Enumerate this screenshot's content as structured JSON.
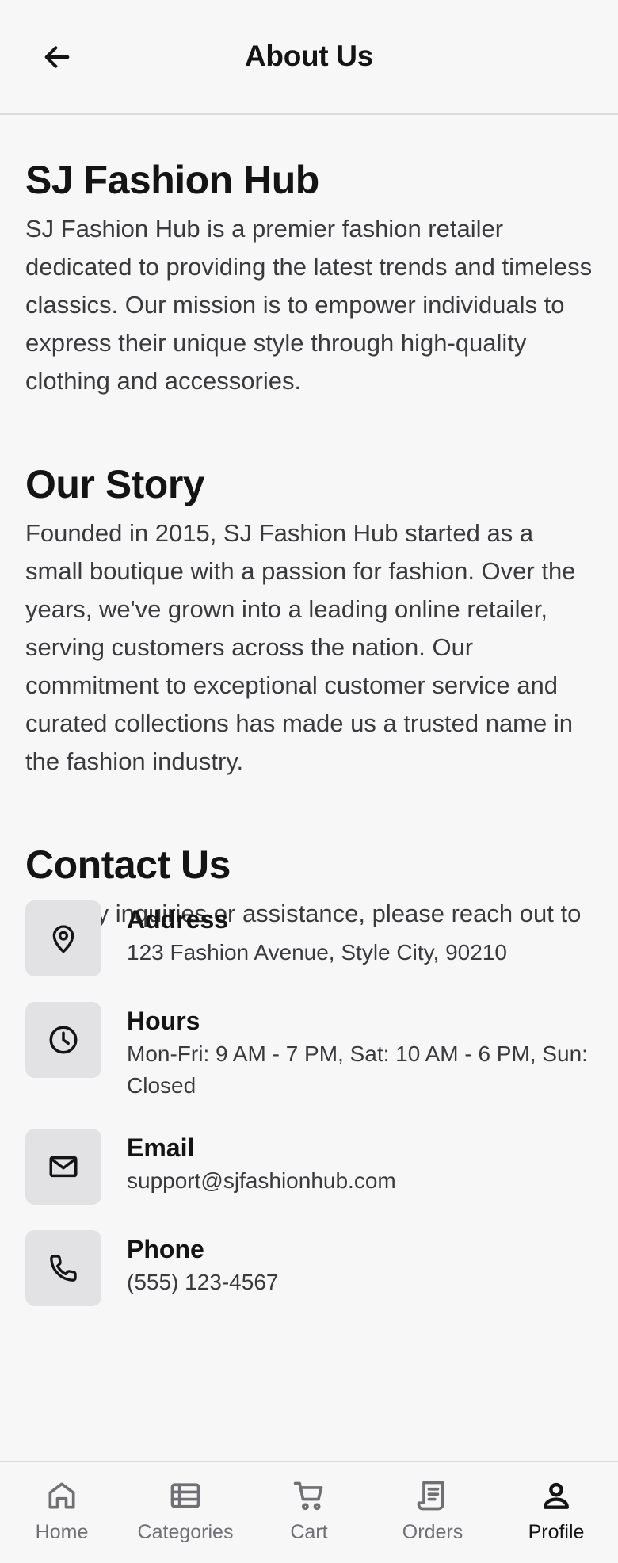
{
  "header": {
    "title": "About Us",
    "back_icon": "arrow-left-icon"
  },
  "sections": {
    "about": {
      "title": "SJ Fashion Hub",
      "text": "SJ Fashion Hub is a premier fashion retailer dedicated to providing the latest trends and timeless classics. Our mission is to empower individuals to express their unique style through high-quality clothing and accessories."
    },
    "story": {
      "title": "Our Story",
      "text": "Founded in 2015, SJ Fashion Hub started as a small boutique with a passion for fashion. Over the years, we've grown into a leading online retailer, serving customers across the nation. Our commitment to exceptional customer service and curated collections has made us a trusted name in the fashion industry."
    },
    "contact": {
      "title": "Contact Us",
      "text": "For any inquiries or assistance, please reach out to us:"
    }
  },
  "contacts": [
    {
      "label": "Address",
      "value": "123 Fashion Avenue, Style City, 90210",
      "icon": "location-pin-icon"
    },
    {
      "label": "Hours",
      "value": "Mon-Fri: 9 AM - 7 PM, Sat: 10 AM - 6 PM, Sun: Closed",
      "icon": "clock-icon"
    },
    {
      "label": "Email",
      "value": "support@sjfashionhub.com",
      "icon": "mail-icon"
    },
    {
      "label": "Phone",
      "value": "(555) 123-4567",
      "icon": "phone-icon"
    }
  ],
  "nav": [
    {
      "label": "Home",
      "icon": "home-icon",
      "active": false
    },
    {
      "label": "Categories",
      "icon": "categories-icon",
      "active": false
    },
    {
      "label": "Cart",
      "icon": "cart-icon",
      "active": false
    },
    {
      "label": "Orders",
      "icon": "receipt-icon",
      "active": false
    },
    {
      "label": "Profile",
      "icon": "profile-icon",
      "active": true
    }
  ],
  "colors": {
    "background": "#f7f7f8",
    "text": "#141414",
    "muted": "#6f6f74",
    "icon_tile": "#e2e2e4"
  }
}
